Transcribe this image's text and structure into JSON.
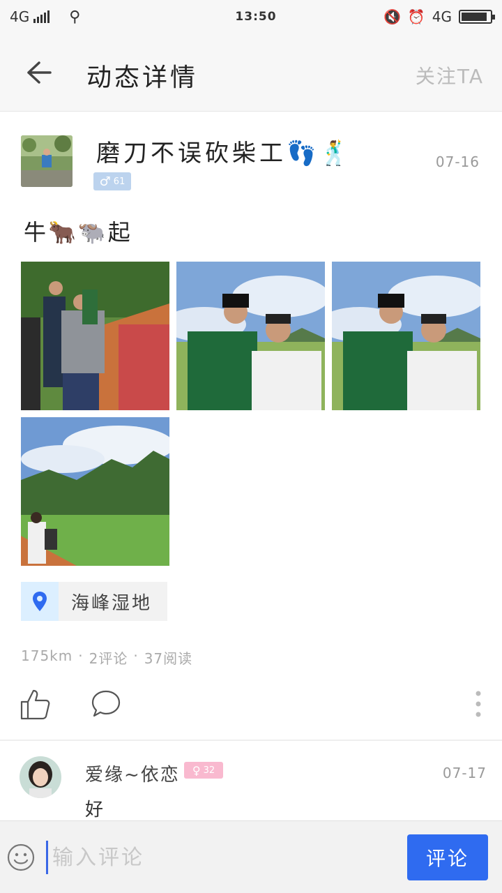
{
  "status_bar": {
    "network_left": "4G",
    "time": "13:50",
    "network_right": "4G"
  },
  "header": {
    "title": "动态详情",
    "follow_label": "关注TA"
  },
  "post": {
    "username": "磨刀不误砍柴工👣🕺",
    "gender_badge": {
      "symbol": "♂",
      "age": "61",
      "color": "#bcd3ee"
    },
    "date": "07-16",
    "text": "牛🐂🐃起",
    "location": "海峰湿地",
    "stats": {
      "distance": "175km",
      "sep1": "·",
      "comments": "2评论",
      "sep2": "·",
      "reads": "37阅读"
    }
  },
  "comment": {
    "username": "爱缘~依恋",
    "gender_badge": {
      "symbol": "♀",
      "age": "32",
      "color": "#f9b9cf"
    },
    "date": "07-17",
    "text": "好"
  },
  "input_bar": {
    "placeholder": "输入评论",
    "submit_label": "评论"
  },
  "colors": {
    "accent": "#2f6bf0",
    "muted_text": "#999999",
    "background": "#ffffff"
  },
  "icons": [
    "back-arrow-icon",
    "location-pin-icon",
    "thumbs-up-icon",
    "comment-bubble-icon",
    "more-vertical-icon",
    "emoji-icon"
  ]
}
